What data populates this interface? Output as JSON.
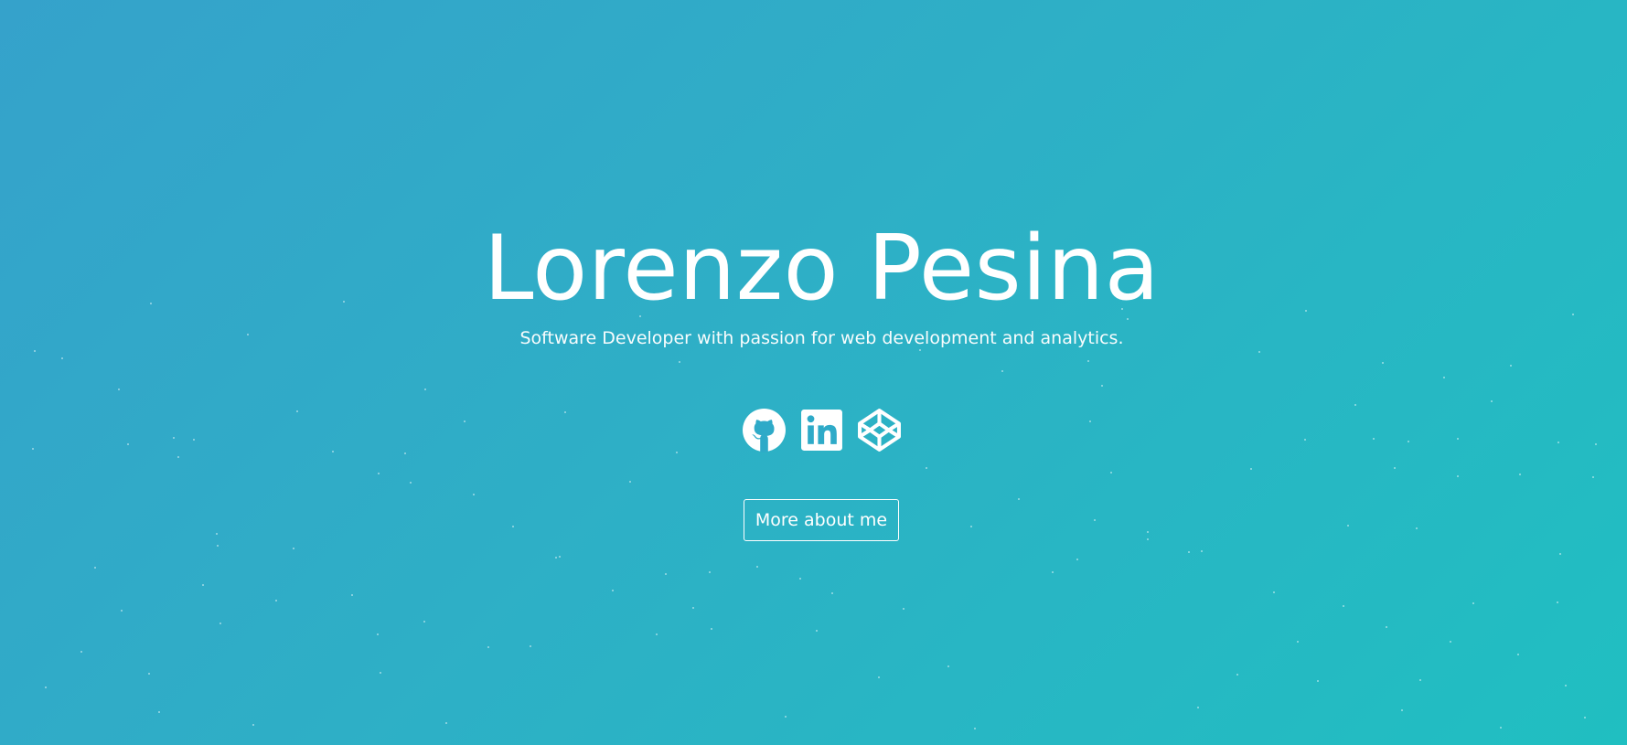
{
  "hero": {
    "name": "Lorenzo Pesina",
    "tagline": "Software Developer with passion for web development and analytics.",
    "cta_label": "More about me",
    "socials": [
      {
        "icon": "github-icon",
        "label": "GitHub"
      },
      {
        "icon": "linkedin-icon",
        "label": "LinkedIn"
      },
      {
        "icon": "codepen-icon",
        "label": "CodePen"
      }
    ]
  },
  "colors": {
    "gradient_start": "#35a2cb",
    "gradient_end": "#20bfc1",
    "text": "#ffffff"
  }
}
